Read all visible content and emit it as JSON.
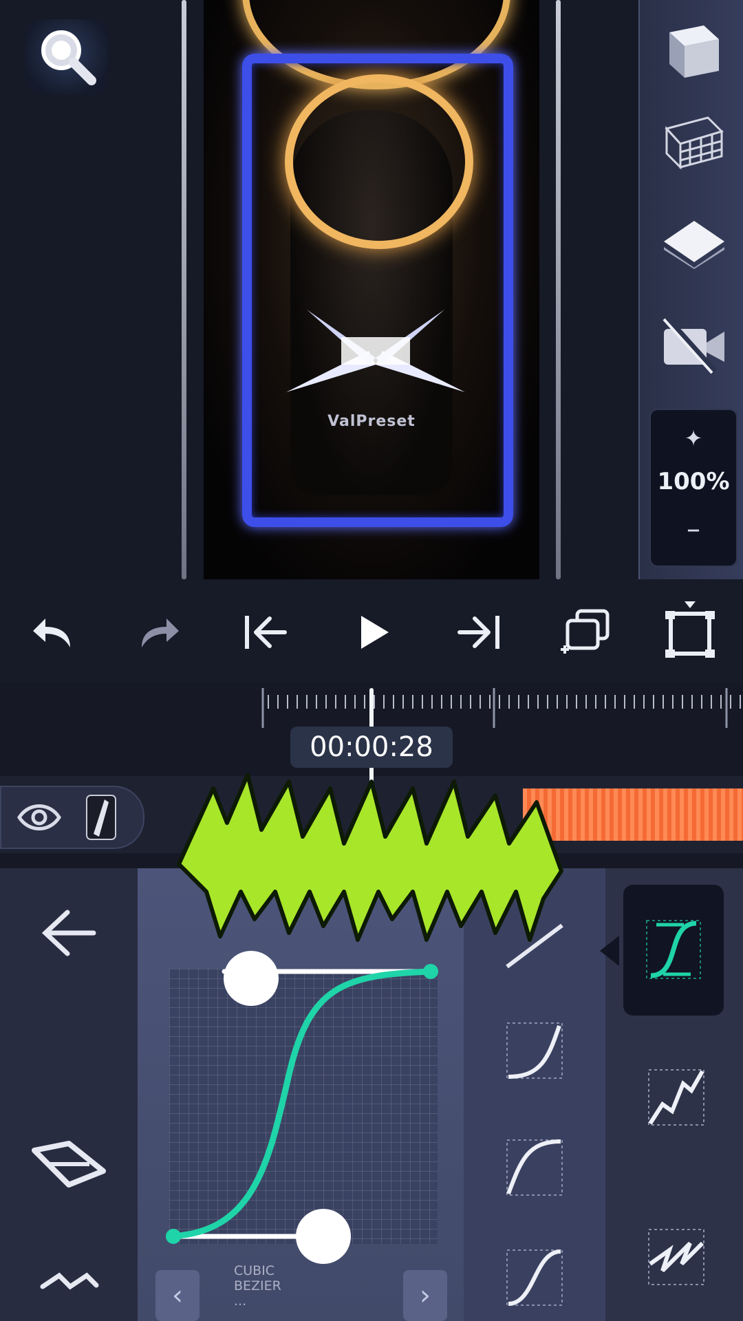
{
  "preview": {
    "watermark": "ValPreset"
  },
  "right_panel": {
    "tools": [
      {
        "icon": "3d-cube-icon"
      },
      {
        "icon": "grid-icon"
      },
      {
        "icon": "layer-icon"
      },
      {
        "icon": "no-camera-icon"
      }
    ],
    "opacity": {
      "value": "100%",
      "star_icon": "sparkle-icon",
      "minus_icon": "minus-icon"
    }
  },
  "playback": {
    "buttons": [
      "undo-icon",
      "redo-icon",
      "skip-start-icon",
      "play-icon",
      "skip-end-icon",
      "copy-icon",
      "crop-icon"
    ]
  },
  "timeline": {
    "current_time": "00:00:28",
    "clip_color": "#f47540"
  },
  "graph": {
    "curve_color": "#1fd4a8",
    "label_lines": [
      "CUBIC",
      "BEZIER",
      "..."
    ]
  },
  "overlay": {
    "logo_color": "#a8e62a",
    "brand": "ValPreset"
  },
  "colors": {
    "accent": "#1fd4a8",
    "frame_border": "#3d4fe8",
    "halo": "#e7b25c"
  }
}
